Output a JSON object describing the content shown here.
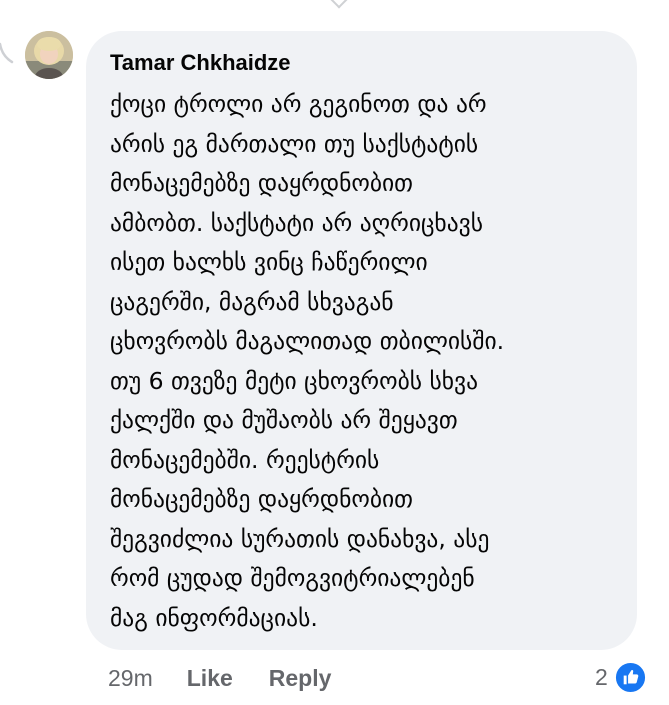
{
  "comment": {
    "author": "Tamar Chkhaidze",
    "lines": [
      "ქოცი ტროლი არ გეგინოთ და არ",
      "არის ეგ მართალი თუ საქსტატის",
      "მონაცემებზე დაყრდნობით",
      "ამბობთ. საქსტატი არ აღრიცხავს",
      "ისეთ ხალხს ვინც ჩაწერილი",
      "ცაგერში, მაგრამ სხვაგან",
      "ცხოვრობს მაგალითად თბილისში.",
      "თუ 6 თვეზე მეტი ცხოვრობს სხვა",
      "ქალქში და მუშაობს არ შეყავთ",
      "მონაცემებში. რეესტრის",
      "მონაცემებზე დაყრდნობით",
      "შეგვიძლია სურათის დანახვა, ასე",
      "რომ ცუდად შემოგვიტრიალებენ",
      "მაგ ინფორმაციას."
    ],
    "time": "29m",
    "like_label": "Like",
    "reply_label": "Reply",
    "reaction_count": "2",
    "reaction_icon": "like-icon",
    "accent_color": "#1877f2"
  }
}
